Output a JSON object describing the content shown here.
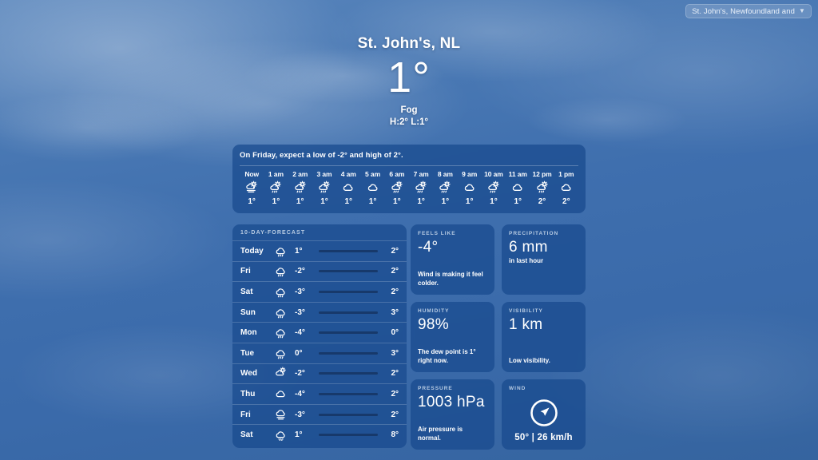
{
  "location_picker": {
    "label": "St. John's, Newfoundland and",
    "chevron": "chevron-down-icon"
  },
  "hero": {
    "city": "St. John's, NL",
    "temperature": "1°",
    "condition": "Fog",
    "high_low": "H:2° L:1°"
  },
  "hourly": {
    "summary": "On Friday, expect a low of -2° and high of 2°.",
    "hours": [
      {
        "label": "Now",
        "icon": "fog-icon",
        "temp": "1°"
      },
      {
        "label": "1 am",
        "icon": "sun-rain-cloud-icon",
        "temp": "1°"
      },
      {
        "label": "2 am",
        "icon": "sun-rain-cloud-icon",
        "temp": "1°"
      },
      {
        "label": "3 am",
        "icon": "sun-rain-cloud-icon",
        "temp": "1°"
      },
      {
        "label": "4 am",
        "icon": "cloud-icon",
        "temp": "1°"
      },
      {
        "label": "5 am",
        "icon": "cloud-icon",
        "temp": "1°"
      },
      {
        "label": "6 am",
        "icon": "sun-rain-cloud-icon",
        "temp": "1°"
      },
      {
        "label": "7 am",
        "icon": "sun-rain-cloud-icon",
        "temp": "1°"
      },
      {
        "label": "8 am",
        "icon": "sun-rain-cloud-icon",
        "temp": "1°"
      },
      {
        "label": "9 am",
        "icon": "cloud-icon",
        "temp": "1°"
      },
      {
        "label": "10 am",
        "icon": "sun-rain-cloud-icon",
        "temp": "1°"
      },
      {
        "label": "11 am",
        "icon": "cloud-icon",
        "temp": "1°"
      },
      {
        "label": "12 pm",
        "icon": "sun-rain-cloud-icon",
        "temp": "2°"
      },
      {
        "label": "1 pm",
        "icon": "cloud-icon",
        "temp": "2°"
      }
    ]
  },
  "ten_day": {
    "header": "10-DAY-FORECAST",
    "days": [
      {
        "name": "Today",
        "icon": "rain-cloud-icon",
        "low": "1°",
        "high": "2°"
      },
      {
        "name": "Fri",
        "icon": "rain-cloud-icon",
        "low": "-2°",
        "high": "2°"
      },
      {
        "name": "Sat",
        "icon": "rain-cloud-icon",
        "low": "-3°",
        "high": "2°"
      },
      {
        "name": "Sun",
        "icon": "rain-cloud-icon",
        "low": "-3°",
        "high": "3°"
      },
      {
        "name": "Mon",
        "icon": "rain-cloud-icon",
        "low": "-4°",
        "high": "0°"
      },
      {
        "name": "Tue",
        "icon": "rain-cloud-icon",
        "low": "0°",
        "high": "3°"
      },
      {
        "name": "Wed",
        "icon": "sun-cloud-icon",
        "low": "-2°",
        "high": "2°"
      },
      {
        "name": "Thu",
        "icon": "cloud-icon",
        "low": "-4°",
        "high": "2°"
      },
      {
        "name": "Fri",
        "icon": "fog-cloud-icon",
        "low": "-3°",
        "high": "2°"
      },
      {
        "name": "Sat",
        "icon": "snow-cloud-icon",
        "low": "1°",
        "high": "8°"
      }
    ]
  },
  "details": {
    "feels_like": {
      "label": "FEELS LIKE",
      "value": "-4°",
      "sub": "Wind is making it feel colder."
    },
    "precip": {
      "label": "PRECIPITATION",
      "value": "6 mm",
      "sub": "in last hour"
    },
    "humidity": {
      "label": "HUMIDITY",
      "value": "98%",
      "sub": "The dew point is 1° right now."
    },
    "visibility": {
      "label": "VISIBILITY",
      "value": "1 km",
      "sub": "Low visibility."
    },
    "pressure": {
      "label": "PRESSURE",
      "value": "1003 hPa",
      "sub": "Air pressure is normal."
    },
    "wind": {
      "label": "WIND",
      "icon": "compass-arrow-icon",
      "value": "50° | 26 km/h"
    }
  },
  "colors": {
    "card_bg": "#184a8e",
    "sky_top": "#5b87bd",
    "sky_bottom": "#35649f",
    "muted_label": "#b9cce3",
    "range_bar": "#17396b"
  }
}
